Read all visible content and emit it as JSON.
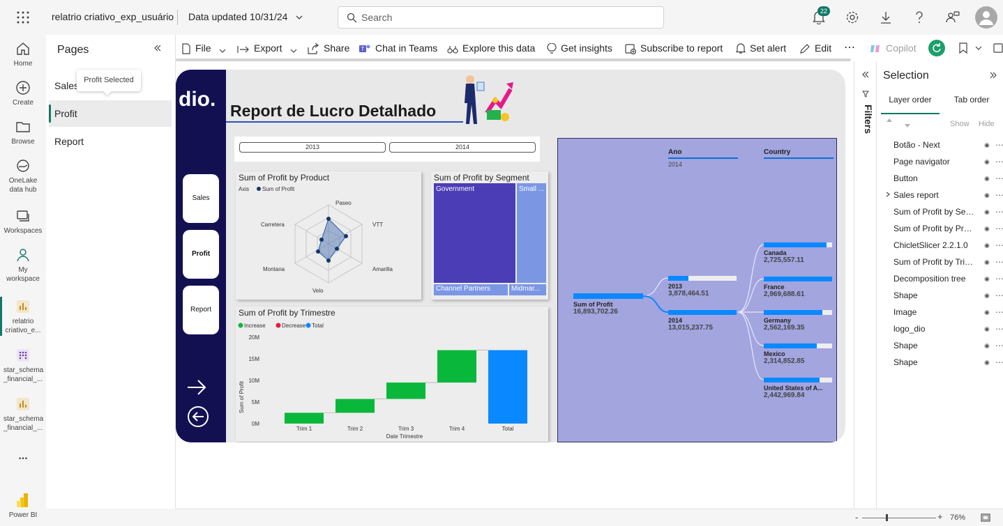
{
  "app": {
    "report_name": "relatrio criativo_exp_usuário",
    "data_updated": "Data updated 10/31/24",
    "search_placeholder": "Search",
    "notification_count": "22"
  },
  "left_rail": [
    {
      "label": "Home",
      "icon": "home-icon"
    },
    {
      "label": "Create",
      "icon": "plus-circle-icon"
    },
    {
      "label": "Browse",
      "icon": "folder-icon"
    },
    {
      "label": "OneLake data hub",
      "icon": "onelake-icon"
    },
    {
      "label": "Workspaces",
      "icon": "workspaces-icon"
    },
    {
      "label": "My workspace",
      "icon": "person-icon"
    },
    {
      "label": "relatrio criativo_e...",
      "icon": "report-icon"
    },
    {
      "label": "star_schema _financial_...",
      "icon": "semantic-model-icon"
    },
    {
      "label": "star_schema _financial_...",
      "icon": "report-icon"
    },
    {
      "label": "...",
      "icon": "more-icon"
    },
    {
      "label": "Power BI",
      "icon": "powerbi-logo-icon"
    }
  ],
  "pages_pane": {
    "title": "Pages",
    "tooltip": "Profit Selected",
    "items": [
      "Sales",
      "Profit",
      "Report"
    ],
    "selected": "Profit"
  },
  "toolbar": {
    "file": "File",
    "export": "Export",
    "share": "Share",
    "chat": "Chat in Teams",
    "explore": "Explore this data",
    "insights": "Get insights",
    "subscribe": "Subscribe to report",
    "alert": "Set alert",
    "edit": "Edit",
    "more": "⋯",
    "copilot": "Copilot"
  },
  "report": {
    "title": "Report de Lucro Detalhado",
    "logo_text": "dio.",
    "nav_buttons": [
      "Sales",
      "Profit",
      "Report"
    ],
    "slicer": [
      "2013",
      "2014"
    ],
    "radar": {
      "title": "Sum of Profit by Product",
      "legend_axis": "Axis",
      "legend_series": "Sum of Profit",
      "axes": [
        "Paseo",
        "VTT",
        "Amarilla",
        "Velo",
        "Montana",
        "Carretera"
      ]
    },
    "treemap": {
      "title": "Sum of Profit by Segment",
      "cells": [
        "Government",
        "Small ...",
        "Channel Partners",
        "Midmar..."
      ]
    },
    "waterfall": {
      "title": "Sum of Profit by Trimestre",
      "legend": [
        "Increase",
        "Decrease",
        "Total"
      ],
      "ylabel": "Sum of Profit",
      "xlabel": "Date Trimestre"
    },
    "decomp": {
      "col1": "Ano",
      "col1_filter": "2014",
      "col2": "Country",
      "root_label": "Sum of Profit",
      "root_value": "16,893,702.26",
      "years": [
        {
          "label": "2013",
          "value": "3,878,464.51",
          "fraction": 0.3
        },
        {
          "label": "2014",
          "value": "13,015,237.75",
          "fraction": 1.0
        }
      ],
      "countries": [
        {
          "label": "Canada",
          "value": "2,725,557.11",
          "fraction": 0.92
        },
        {
          "label": "France",
          "value": "2,969,688.61",
          "fraction": 1.0
        },
        {
          "label": "Germany",
          "value": "2,562,169.35",
          "fraction": 0.86
        },
        {
          "label": "Mexico",
          "value": "2,314,852.85",
          "fraction": 0.78
        },
        {
          "label": "United States of A...",
          "value": "2,442,969.84",
          "fraction": 0.82
        }
      ]
    }
  },
  "chart_data": {
    "type": "bar",
    "title": "Sum of Profit by Trimestre",
    "categories": [
      "Trim 1",
      "Trim 2",
      "Trim 3",
      "Trim 4",
      "Total"
    ],
    "series": [
      {
        "name": "Increase",
        "start": [
          0,
          2.5,
          5.7,
          9.5,
          null
        ],
        "end": [
          2.5,
          5.7,
          9.5,
          17.0,
          null
        ],
        "color": "#09b83b"
      },
      {
        "name": "Total",
        "start": [
          null,
          null,
          null,
          null,
          0
        ],
        "end": [
          null,
          null,
          null,
          null,
          17.0
        ],
        "color": "#0a88ff"
      }
    ],
    "ylabel": "Sum of Profit",
    "xlabel": "Date Trimestre",
    "yticks": [
      "0M",
      "5M",
      "10M",
      "15M",
      "20M"
    ],
    "ylim": [
      0,
      20
    ]
  },
  "selection_pane": {
    "title": "Selection",
    "tab_layer": "Layer order",
    "tab_tab": "Tab order",
    "show": "Show",
    "hide": "Hide",
    "layers": [
      "Botão - Next",
      "Page navigator",
      "Button",
      "Sales report",
      "Sum of Profit by Seg...",
      "Sum of Profit by Prod...",
      "ChicletSlicer 2.2.1.0",
      "Sum of Profit by Trim...",
      "Decomposition tree",
      "Shape",
      "Image",
      "logo_dio",
      "Shape",
      "Shape"
    ]
  },
  "filters_label": "Filters",
  "status": {
    "zoom": "76%"
  },
  "colors": {
    "navy": "#131052",
    "accent": "#117865",
    "decomp_bg": "#a2a5de",
    "bar_blue": "#0a88ff",
    "increase": "#09b83b",
    "decrease": "#e81b46"
  }
}
